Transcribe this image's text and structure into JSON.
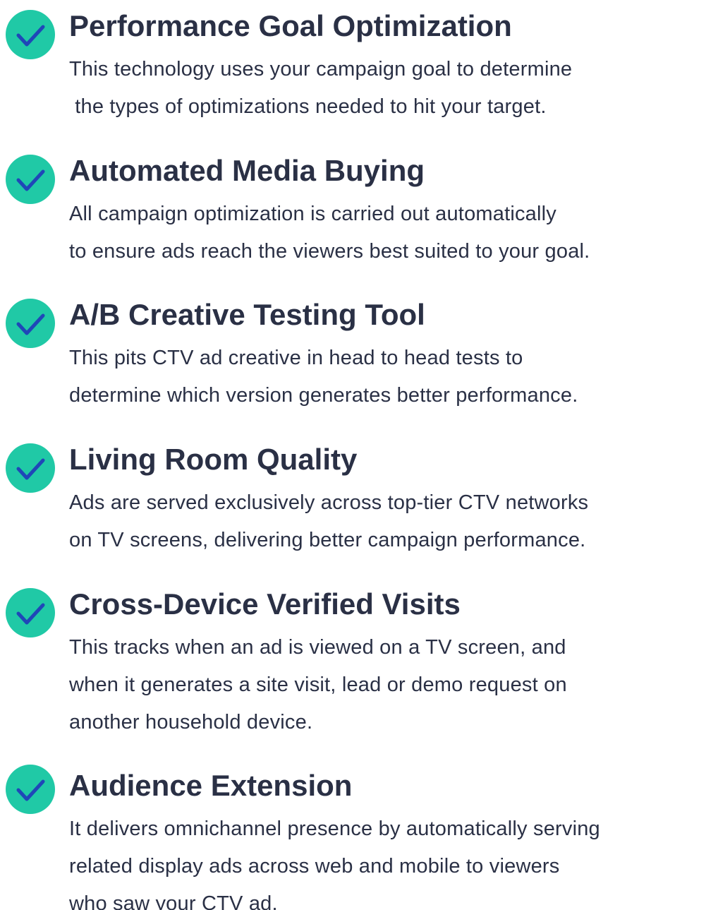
{
  "colors": {
    "check_fill": "#20c9a6",
    "check_mark": "#1f47b8",
    "text": "#2a3045"
  },
  "features": [
    {
      "icon": "check-circle-icon",
      "title": "Performance Goal Optimization",
      "lines": [
        "This technology uses your campaign goal to determine",
        " the types of optimizations needed to hit your target."
      ]
    },
    {
      "icon": "check-circle-icon",
      "title": "Automated Media Buying",
      "lines": [
        "All campaign optimization is carried out automatically",
        "to ensure ads reach the viewers best suited to your goal."
      ]
    },
    {
      "icon": "check-circle-icon",
      "title": "A/B Creative Testing Tool",
      "lines": [
        "This pits CTV ad creative in head to head tests to",
        "determine which version generates better performance."
      ]
    },
    {
      "icon": "check-circle-icon",
      "title": "Living Room Quality",
      "lines": [
        "Ads are served exclusively across top-tier CTV networks",
        "on TV screens, delivering better campaign performance."
      ]
    },
    {
      "icon": "check-circle-icon",
      "title": "Cross-Device Verified Visits",
      "lines": [
        "This tracks when an ad is viewed on a TV screen, and",
        "when it generates a site visit, lead or demo request on",
        "another household device."
      ]
    },
    {
      "icon": "check-circle-icon",
      "title": "Audience Extension",
      "lines": [
        "It delivers omnichannel presence by automatically serving",
        "related display ads across web and mobile to viewers",
        "who saw your CTV ad."
      ]
    }
  ]
}
